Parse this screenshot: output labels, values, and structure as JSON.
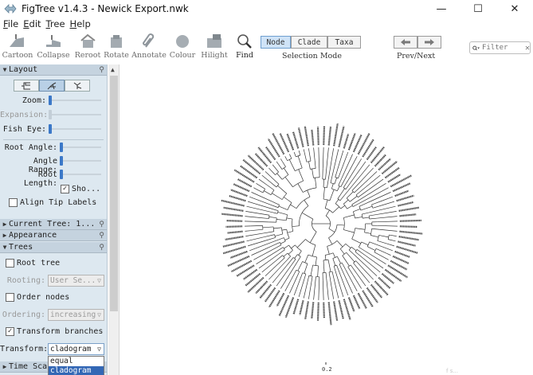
{
  "window": {
    "title": "FigTree v1.4.3 - Newick Export.nwk",
    "controls": {
      "minimize": "—",
      "maximize": "☐",
      "close": "✕"
    }
  },
  "menu": [
    {
      "label": "File",
      "accel": "F",
      "rest": "ile"
    },
    {
      "label": "Edit",
      "accel": "E",
      "rest": "dit"
    },
    {
      "label": "Tree",
      "accel": "T",
      "rest": "ree"
    },
    {
      "label": "Help",
      "accel": "H",
      "rest": "elp"
    }
  ],
  "toolbar": {
    "tools": [
      {
        "label": "Cartoon",
        "icon": "cartoon-icon"
      },
      {
        "label": "Collapse",
        "icon": "collapse-icon"
      },
      {
        "label": "Reroot",
        "icon": "reroot-icon"
      },
      {
        "label": "Rotate",
        "icon": "rotate-icon"
      },
      {
        "label": "Annotate",
        "icon": "paperclip-icon"
      },
      {
        "label": "Colour",
        "icon": "colour-circle-icon"
      },
      {
        "label": "Hilight",
        "icon": "hilight-icon"
      },
      {
        "label": "Find",
        "icon": "magnifier-icon"
      }
    ],
    "selection_mode": {
      "caption": "Selection Mode",
      "options": [
        "Node",
        "Clade",
        "Taxa"
      ],
      "selected": "Node"
    },
    "prev_next": {
      "caption": "Prev/Next",
      "prev_icon": "arrow-left-icon",
      "next_icon": "arrow-right-icon"
    },
    "filter": {
      "placeholder": "Filter",
      "icon": "search-dropdown-icon",
      "clear": "✕"
    }
  },
  "panel": {
    "layout": {
      "title": "Layout",
      "zoom_label": "Zoom:",
      "expansion_label": "Expansion:",
      "fish_eye_label": "Fish Eye:",
      "root_angle_label": "Root Angle:",
      "angle_range_label": "Angle Range:",
      "root_length_label": "Root Length:",
      "show_label": "Sho...",
      "show_checked": true,
      "align_tip_labels": "Align Tip Labels",
      "align_checked": false,
      "zoom": 0.0,
      "expansion": 0.0,
      "fish_eye": 0.0,
      "root_angle": 0.0,
      "angle_range": 0.0,
      "root_length": 0.0
    },
    "current_tree": {
      "title": "Current Tree: 1..."
    },
    "appearance": {
      "title": "Appearance"
    },
    "trees": {
      "title": "Trees",
      "root_tree": "Root tree",
      "root_checked": false,
      "rooting_label": "Rooting:",
      "rooting_value": "User Se...",
      "order_nodes": "Order nodes",
      "order_checked": false,
      "ordering_label": "Ordering:",
      "ordering_value": "increasing",
      "transform_branches": "Transform branches",
      "transform_checked": true,
      "transform_label": "Transform:",
      "transform_value": "cladogram",
      "transform_options": [
        "equal",
        "cladogram"
      ]
    },
    "time_scale": {
      "title": "Time Sca"
    }
  },
  "canvas": {
    "scale_label": "0.2",
    "watermark": "f s..."
  },
  "colors": {
    "accent": "#3b78c8",
    "panel_bg": "#dde8f0",
    "header_bg": "#c5d3df",
    "selected": "#cfe3f7"
  }
}
